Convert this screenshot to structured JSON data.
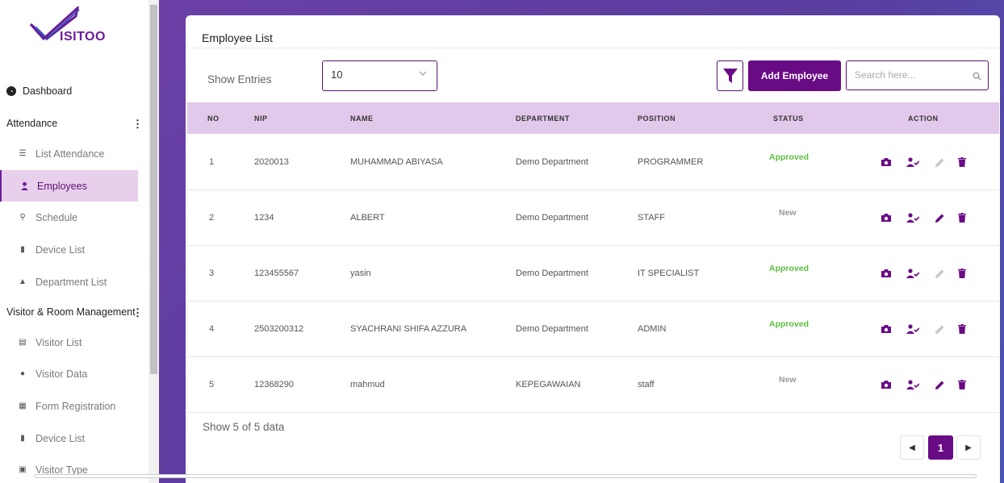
{
  "brand": {
    "logo_text": "ISITOO"
  },
  "sidebar": {
    "dashboard": "Dashboard",
    "sections": [
      {
        "title": "Attendance",
        "items": [
          "List Attendance",
          "Employees",
          "Schedule",
          "Device List",
          "Department List"
        ]
      },
      {
        "title": "Visitor & Room Management",
        "items": [
          "Visitor List",
          "Visitor Data",
          "Form Registration",
          "Device List",
          "Visitor Type"
        ]
      }
    ],
    "active_item": "Employees"
  },
  "card": {
    "title": "Employee List",
    "show_entries_label": "Show Entries",
    "entries_value": "10",
    "add_button": "Add Employee",
    "search_placeholder": "Search here..."
  },
  "table": {
    "columns": [
      "NO",
      "NIP",
      "NAME",
      "DEPARTMENT",
      "POSITION",
      "STATUS",
      "ACTION"
    ],
    "rows": [
      {
        "no": "1",
        "nip": "2020013",
        "name": "MUHAMMAD ABIYASA",
        "department": "Demo Department",
        "position": "PROGRAMMER",
        "status": "Approved"
      },
      {
        "no": "2",
        "nip": "1234",
        "name": "ALBERT",
        "department": "Demo Department",
        "position": "STAFF",
        "status": "New"
      },
      {
        "no": "3",
        "nip": "123455567",
        "name": "yasin",
        "department": "Demo Department",
        "position": "IT SPECIALIST",
        "status": "Approved"
      },
      {
        "no": "4",
        "nip": "2503200312",
        "name": "SYACHRANI SHIFA AZZURA",
        "department": "Demo Department",
        "position": "ADMIN",
        "status": "Approved"
      },
      {
        "no": "5",
        "nip": "12368290",
        "name": "mahmud",
        "department": "KEPEGAWAIAN",
        "position": "staff",
        "status": "New"
      }
    ]
  },
  "footer": {
    "summary": "Show 5 of 5 data",
    "current_page": "1"
  },
  "colors": {
    "primary": "#6a0b86",
    "approved": "#5cbe3e",
    "header_bg": "#e2c8ea",
    "active_nav_bg": "#e8cfec"
  }
}
